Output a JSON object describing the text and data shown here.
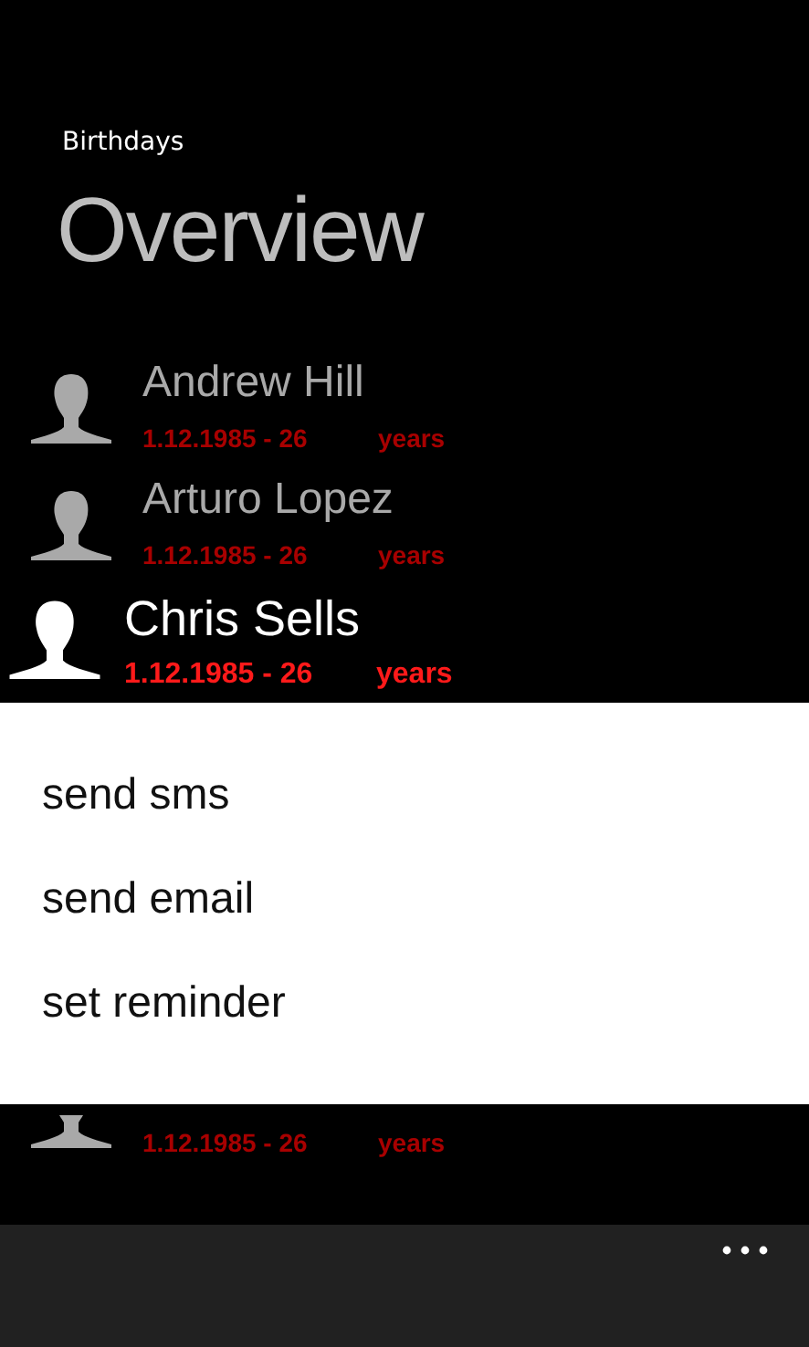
{
  "app_title": "Birthdays",
  "page_title": "Overview",
  "people": [
    {
      "name": "Andrew Hill",
      "date": "1.12.1985 - 26",
      "unit": "years",
      "selected": false
    },
    {
      "name": "Arturo Lopez",
      "date": "1.12.1985 - 26",
      "unit": "years",
      "selected": false
    },
    {
      "name": "Chris Sells",
      "date": "1.12.1985 - 26",
      "unit": "years",
      "selected": true
    },
    {
      "date": "1.12.1985 - 26",
      "unit": "years",
      "selected": false
    }
  ],
  "context_menu": [
    "send sms",
    "send email",
    "set reminder"
  ]
}
